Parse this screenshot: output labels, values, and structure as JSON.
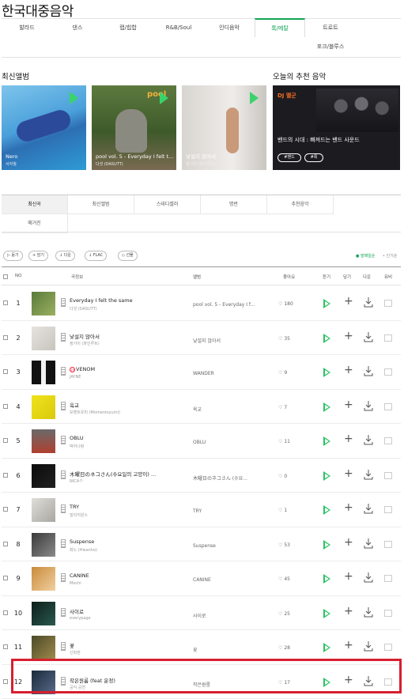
{
  "title": "한국대중음악",
  "genres": [
    "발라드",
    "댄스",
    "랩/힙합",
    "R&B/Soul",
    "인디음악",
    "록/메탈",
    "트로트",
    "포크/블루스"
  ],
  "active_genre": "록/메탈",
  "new_albums_title": "최신앨범",
  "recommend_title": "오늘의 추천 음악",
  "albums": [
    {
      "title": "Nero",
      "artist": "서자월"
    },
    {
      "title": "pool vol. 5 - Everyday I felt t...",
      "artist": "다섯 (DASUTT)"
    },
    {
      "title": "낯설지 않아서",
      "artist": "정가이 (파인루트)"
    }
  ],
  "recommend": {
    "dj": "DJ 멜군",
    "text": "밴드의 시대 : 빠져드는 밴드 사운드",
    "tags": [
      "#밴드",
      "#록"
    ]
  },
  "subtabs": [
    "최신곡",
    "최신앨범",
    "스테디셀러",
    "명반",
    "추천음악",
    "매거진"
  ],
  "active_subtab": "최신곡",
  "actions": [
    "듣기",
    "담기",
    "다운",
    "FLAC",
    "선물"
  ],
  "top_links": [
    "● 발매일순",
    "• 인기순"
  ],
  "headers": {
    "no": "NO",
    "song": "곡정보",
    "album": "앨범",
    "like": "좋아요",
    "listen": "듣기",
    "add": "담기",
    "download": "다운",
    "mv": "뮤비"
  },
  "songs": [
    {
      "rank": "1",
      "title": "Everyday I felt the same",
      "artist": "다섯 (DASUTT)",
      "album": "pool vol. 5 - Everyday I f...",
      "likes": "180"
    },
    {
      "rank": "2",
      "title": "낯설지 않아서",
      "artist": "정가이 (파인루트)",
      "album": "낯설지 않아서",
      "likes": "35"
    },
    {
      "rank": "3",
      "title": "VENOM",
      "artist": "JAYNE",
      "album": "WANDER",
      "likes": "9",
      "badge": "19"
    },
    {
      "rank": "4",
      "title": "옥교",
      "artist": "모멘트유미 (Momentsyumi)",
      "album": "옥교",
      "likes": "7"
    },
    {
      "rank": "5",
      "title": "OBLU",
      "artist": "박아나랑",
      "album": "OBLU",
      "likes": "11"
    },
    {
      "rank": "6",
      "title": "木曜日のネコさん(수요일의 고양이) ...",
      "artist": "NICA个",
      "album": "木曜日のネコさん (수요...",
      "likes": "0"
    },
    {
      "rank": "7",
      "title": "TRY",
      "artist": "빌리지원스",
      "album": "TRY",
      "likes": "1"
    },
    {
      "rank": "8",
      "title": "Suspense",
      "artist": "화노 (Hwanho)",
      "album": "Suspense",
      "likes": "53"
    },
    {
      "rank": "9",
      "title": "CANINE",
      "artist": "Mochi",
      "album": "CANINE",
      "likes": "45"
    },
    {
      "rank": "10",
      "title": "사이로",
      "artist": "everypage",
      "album": "사이로",
      "likes": "25"
    },
    {
      "rank": "11",
      "title": "꽃",
      "artist": "신파한",
      "album": "꽃",
      "likes": "28"
    },
    {
      "rank": "12",
      "title": "작은원룸 (feat 운정)",
      "artist": "공익 공연",
      "album": "작은원룸",
      "likes": "17"
    }
  ],
  "colors": {
    "accent": "#13a456",
    "play": "#2cc264",
    "highlight": "#d71f2e"
  }
}
